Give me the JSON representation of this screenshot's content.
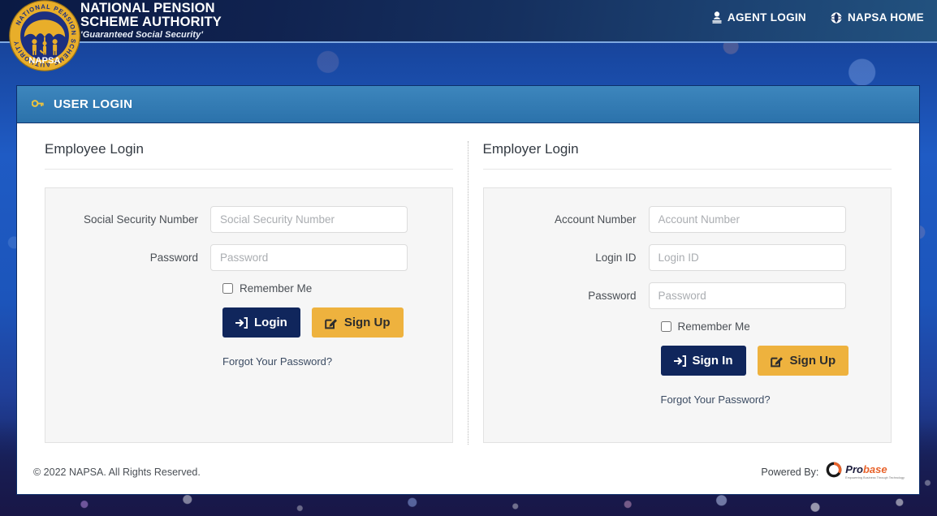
{
  "header": {
    "brand_line1": "NATIONAL PENSION",
    "brand_line2": "SCHEME AUTHORITY",
    "tagline": "'Guaranteed Social Security'",
    "logo_ring_text": "NATIONAL PENSION SCHEME AUTHORITY",
    "logo_acronym": "NAPSA",
    "nav": [
      {
        "label": "AGENT LOGIN",
        "icon": "user-icon"
      },
      {
        "label": "NAPSA HOME",
        "icon": "globe-icon"
      }
    ]
  },
  "card": {
    "title": "USER LOGIN",
    "title_icon": "key-icon"
  },
  "employee": {
    "section_title": "Employee Login",
    "fields": [
      {
        "label": "Social Security Number",
        "placeholder": "Social Security Number",
        "value": "",
        "type": "text"
      },
      {
        "label": "Password",
        "placeholder": "Password",
        "value": "",
        "type": "password"
      }
    ],
    "remember_label": "Remember Me",
    "remember_checked": false,
    "primary_button": {
      "label": "Login",
      "icon": "sign-in-icon"
    },
    "secondary_button": {
      "label": "Sign Up",
      "icon": "pencil-square-icon"
    },
    "forgot_label": "Forgot Your Password?"
  },
  "employer": {
    "section_title": "Employer Login",
    "fields": [
      {
        "label": "Account Number",
        "placeholder": "Account Number",
        "value": "",
        "type": "text"
      },
      {
        "label": "Login ID",
        "placeholder": "Login ID",
        "value": "",
        "type": "text"
      },
      {
        "label": "Password",
        "placeholder": "Password",
        "value": "",
        "type": "password"
      }
    ],
    "remember_label": "Remember Me",
    "remember_checked": false,
    "primary_button": {
      "label": "Sign In",
      "icon": "sign-in-icon"
    },
    "secondary_button": {
      "label": "Sign Up",
      "icon": "pencil-square-icon"
    },
    "forgot_label": "Forgot Your Password?"
  },
  "footer": {
    "copyright": "© 2022 NAPSA. All Rights Reserved.",
    "powered_label": "Powered By:",
    "vendor_name_part1": "Pro",
    "vendor_name_part2": "base",
    "vendor_tagline": "Empowering Business Through Technology"
  },
  "colors": {
    "header_gradient_start": "#0a1a44",
    "header_gradient_end": "#22527f",
    "card_header_blue": "#2b72ab",
    "primary_navy": "#10265c",
    "accent_gold": "#eeb23e",
    "page_blue": "#1b4fb5",
    "vendor_orange": "#e8622a"
  }
}
